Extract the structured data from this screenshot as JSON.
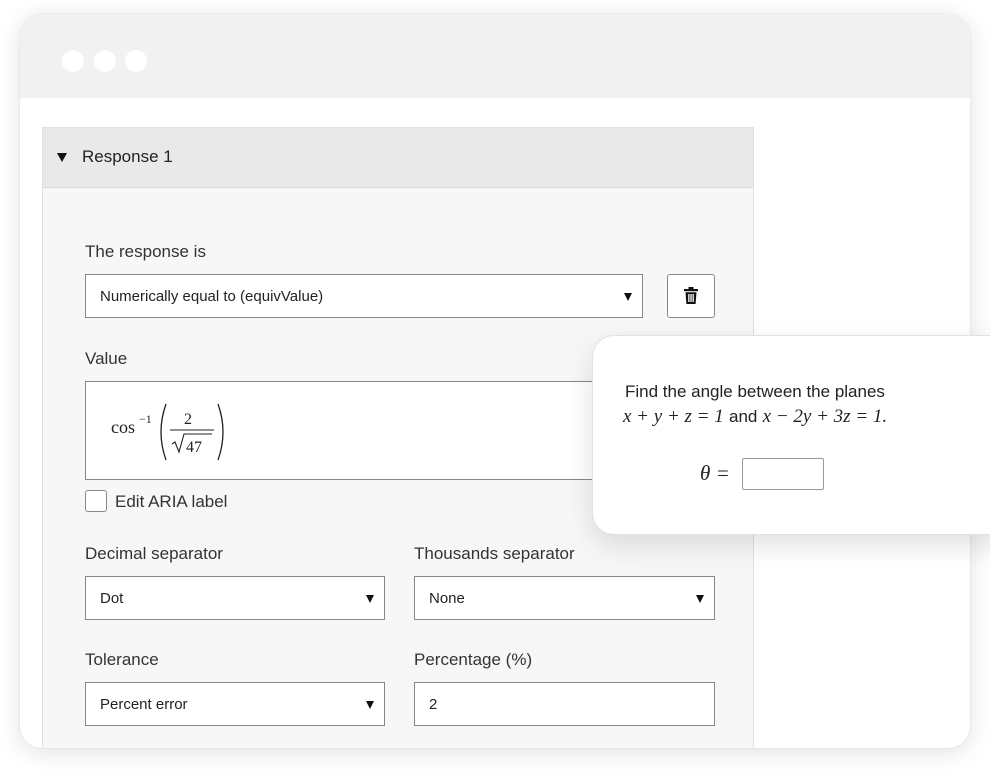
{
  "window": {
    "controls": [
      "close-dot",
      "minimize-dot",
      "maximize-dot"
    ]
  },
  "response_panel": {
    "header": "Response 1",
    "response_is_label": "The response is",
    "response_type": {
      "selected": "Numerically equal to (equivValue)"
    },
    "delete_icon": "trash-icon",
    "value_label": "Value",
    "value_expression": {
      "func": "cos",
      "exponent": "−1",
      "numerator": "2",
      "radicand": "47"
    },
    "edit_aria_label": "Edit ARIA label",
    "edit_aria_checked": false,
    "decimal_separator": {
      "label": "Decimal separator",
      "selected": "Dot"
    },
    "thousands_separator": {
      "label": "Thousands separator",
      "selected": "None"
    },
    "tolerance": {
      "label": "Tolerance",
      "selected": "Percent error"
    },
    "percentage": {
      "label": "Percentage (%)",
      "value": "2"
    }
  },
  "question_popup": {
    "line1": "Find the angle between the planes",
    "plane1": "x + y + z = 1",
    "connector": "and",
    "plane2": "x − 2y + 3z = 1.",
    "answer_variable": "θ =",
    "answer_value": ""
  }
}
